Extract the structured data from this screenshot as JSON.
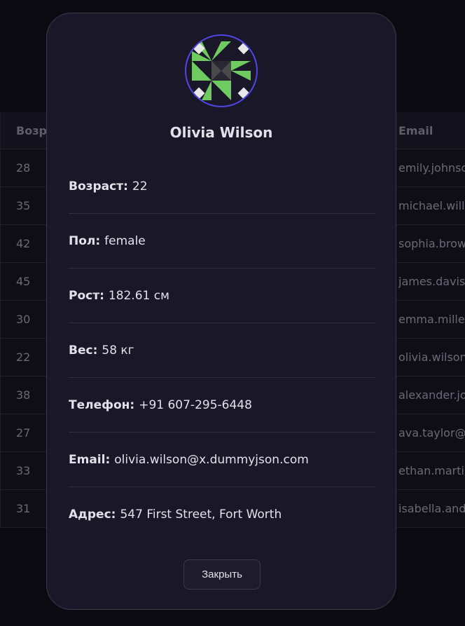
{
  "table": {
    "headers": {
      "age": "Возраст",
      "email": "Email"
    },
    "rows": [
      {
        "age": "28",
        "email": "emily.johnson@x.dummyjson.com"
      },
      {
        "age": "35",
        "email": "michael.williams@x.dummyjson.com"
      },
      {
        "age": "42",
        "email": "sophia.brown@x.dummyjson.com"
      },
      {
        "age": "45",
        "email": "james.davis@x.dummyjson.com"
      },
      {
        "age": "30",
        "email": "emma.miller@x.dummyjson.com"
      },
      {
        "age": "22",
        "email": "olivia.wilson@x.dummyjson.com"
      },
      {
        "age": "38",
        "email": "alexander.jones@x.dummyjson.com"
      },
      {
        "age": "27",
        "email": "ava.taylor@x.dummyjson.com"
      },
      {
        "age": "33",
        "email": "ethan.martinez@x.dummyjson.com"
      },
      {
        "age": "31",
        "email": "isabella.anderson@x.dummyjson.com"
      }
    ]
  },
  "modal": {
    "name": "Olivia Wilson",
    "fields": [
      {
        "label": "Возраст:",
        "value": "22"
      },
      {
        "label": "Пол:",
        "value": "female"
      },
      {
        "label": "Рост:",
        "value": "182.61 см"
      },
      {
        "label": "Вес:",
        "value": "58 кг"
      },
      {
        "label": "Телефон:",
        "value": "+91 607-295-6448"
      },
      {
        "label": "Email:",
        "value": "olivia.wilson@x.dummyjson.com"
      },
      {
        "label": "Адрес:",
        "value": "547 First Street, Fort Worth"
      }
    ],
    "close_label": "Закрыть"
  },
  "colors": {
    "accent": "#4f46e5",
    "identicon_green": "#6fcb5f",
    "identicon_gray": "#4a4a4a"
  }
}
